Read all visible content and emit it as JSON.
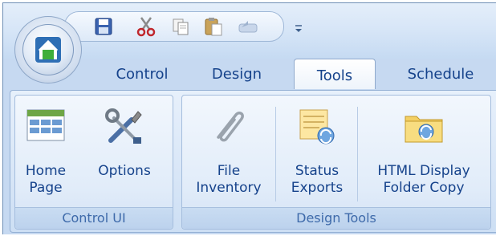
{
  "quick_access": {
    "icons": [
      "save-icon",
      "cut-icon",
      "copy-icon",
      "paste-icon",
      "undo-icon"
    ],
    "dropdown_icon": "qat-dropdown-icon"
  },
  "app_button": {
    "icon": "house-icon"
  },
  "tabs": [
    {
      "label": "Control",
      "active": false
    },
    {
      "label": "Design",
      "active": false
    },
    {
      "label": "Tools",
      "active": true
    },
    {
      "label": "Schedule",
      "active": false
    }
  ],
  "groups": [
    {
      "label": "Control UI",
      "buttons": [
        {
          "line1": "Home",
          "line2": "Page",
          "icon": "home-page-grid-icon"
        },
        {
          "line1": "Options",
          "line2": "",
          "icon": "wrench-hammer-icon"
        }
      ]
    },
    {
      "label": "Design Tools",
      "buttons": [
        {
          "line1": "File",
          "line2": "Inventory",
          "icon": "paperclip-icon"
        },
        {
          "line1": "Status",
          "line2": "Exports",
          "icon": "status-export-icon"
        },
        {
          "line1": "HTML Display",
          "line2": "Folder Copy",
          "icon": "folder-sync-icon"
        }
      ]
    }
  ]
}
